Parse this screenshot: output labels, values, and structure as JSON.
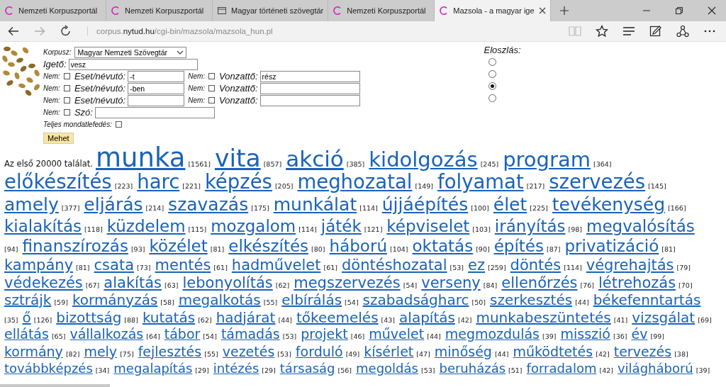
{
  "browser": {
    "tabs": [
      {
        "title": "Nemzeti Korpuszportál",
        "kind": "logo",
        "selected": false
      },
      {
        "title": "Nemzeti Korpuszportál",
        "kind": "logo",
        "selected": false
      },
      {
        "title": "Magyar történeti szövegtár",
        "kind": "page",
        "selected": false
      },
      {
        "title": "Nemzeti Korpuszportál",
        "kind": "logo",
        "selected": false
      },
      {
        "title": "Mazsola - a magyar ige",
        "kind": "logo",
        "selected": true
      }
    ],
    "url": "corpus.**nytud.hu**/cgi-bin/mazsola/mazsola_hun.pl"
  },
  "form": {
    "corpus_label": "Korpusz:",
    "corpus_value": "Magyar Nemzeti Szövegtár",
    "stem_label": "Igető:",
    "stem_value": "vesz",
    "filter_rows": [
      {
        "fields": [
          {
            "neg_label": "Nem:",
            "checked": false,
            "label": "Eset/névutó:",
            "value": "-t",
            "kind": "short"
          },
          {
            "neg_label": "Nem:",
            "checked": false,
            "label": "Vonzattő:",
            "value": "rész",
            "kind": "long"
          }
        ]
      },
      {
        "fields": [
          {
            "neg_label": "Nem:",
            "checked": false,
            "label": "Eset/névutó:",
            "value": "-ben",
            "kind": "short"
          },
          {
            "neg_label": "Nem:",
            "checked": false,
            "label": "Vonzattő:",
            "kind": "long"
          }
        ]
      },
      {
        "fields": [
          {
            "neg_label": "Nem:",
            "checked": false,
            "label": "Eset/névutó:",
            "kind": "short"
          },
          {
            "neg_label": "Nem:",
            "checked": false,
            "label": "Vonzattő:",
            "kind": "long"
          }
        ]
      },
      {
        "fields": [
          {
            "neg_label": "Nem:",
            "checked": false,
            "label": "Szó:",
            "kind": "word"
          }
        ]
      }
    ],
    "full_cover_label": "Teljes mondatlefedés:",
    "full_cover_checked": false,
    "submit": "Mehet",
    "distribution_label": "Eloszlás:",
    "distribution_options": [
      {
        "selected": false
      },
      {
        "selected": false
      },
      {
        "selected": true
      },
      {
        "selected": false
      }
    ]
  },
  "results": {
    "summary": "Az első 20000 találat.",
    "rows": [
      {
        "kind": "big",
        "items": [
          {
            "word": "munka",
            "count": "[1561]",
            "kind": "giant"
          },
          {
            "word": "vita",
            "count": "[857]",
            "kind": "huge"
          },
          {
            "word": "akció",
            "count": "[385]",
            "kind": "large"
          },
          {
            "word": "kidolgozás",
            "count": "[245]",
            "kind": "bigger"
          },
          {
            "word": "program",
            "count": "[364]",
            "kind": "bigger"
          }
        ]
      },
      {
        "kind": "big",
        "items": [
          {
            "word": "előkészítés",
            "count": "[223]"
          },
          {
            "word": "harc",
            "count": "[221]"
          },
          {
            "word": "képzés",
            "count": "[205]"
          },
          {
            "word": "meghozatal",
            "count": "[149]"
          },
          {
            "word": "folyamat",
            "count": "[217]"
          },
          {
            "word": "szervezés",
            "count": "[145]"
          }
        ]
      },
      {
        "kind": "medium",
        "items": [
          {
            "word": "amely",
            "count": "[377]"
          },
          {
            "word": "eljárás",
            "count": "[214]"
          },
          {
            "word": "szavazás",
            "count": "[175]"
          },
          {
            "word": "munkálat",
            "count": "[114]"
          },
          {
            "word": "újjáépítés",
            "count": "[100]"
          },
          {
            "word": "élet",
            "count": "[225]"
          },
          {
            "word": "tevékenység",
            "count": "[166]"
          }
        ]
      },
      {
        "kind": "normal",
        "items": [
          {
            "word": "kialakítás",
            "count": "[118]"
          },
          {
            "word": "küzdelem",
            "count": "[115]"
          },
          {
            "word": "mozgalom",
            "count": "[114]"
          },
          {
            "word": "játék",
            "count": "[121]"
          },
          {
            "word": "képviselet",
            "count": "[103]"
          },
          {
            "word": "irányítás",
            "count": "[98]"
          },
          {
            "word": "megvalósítás"
          }
        ]
      },
      {
        "kind": "normal",
        "items": [
          {
            "count": "[94]"
          },
          {
            "word": "finanszírozás",
            "count": "[93]"
          },
          {
            "word": "közélet",
            "count": "[81]"
          },
          {
            "word": "elkészítés",
            "count": "[80]"
          },
          {
            "word": "háború",
            "count": "[104]"
          },
          {
            "word": "oktatás",
            "count": "[90]"
          },
          {
            "word": "építés",
            "count": "[87]"
          },
          {
            "word": "privatizáció",
            "count": "[81]"
          }
        ]
      },
      {
        "kind": "small",
        "items": [
          {
            "word": "kampány",
            "count": "[81]"
          },
          {
            "word": "csata",
            "count": "[73]"
          },
          {
            "word": "mentés",
            "count": "[61]"
          },
          {
            "word": "hadművelet",
            "count": "[61]"
          },
          {
            "word": "döntéshozatal",
            "count": "[53]"
          },
          {
            "word": "ez",
            "count": "[259]"
          },
          {
            "word": "döntés",
            "count": "[114]"
          },
          {
            "word": "végrehajtás",
            "count": "[79]"
          }
        ]
      },
      {
        "kind": "small",
        "items": [
          {
            "word": "védekezés",
            "count": "[67]"
          },
          {
            "word": "alakítás",
            "count": "[63]"
          },
          {
            "word": "lebonyolítás",
            "count": "[62]"
          },
          {
            "word": "megszervezés",
            "count": "[54]"
          },
          {
            "word": "verseny",
            "count": "[84]"
          },
          {
            "word": "ellenőrzés",
            "count": "[76]"
          },
          {
            "word": "létrehozás",
            "count": "[70]"
          }
        ]
      },
      {
        "kind": "smaller",
        "items": [
          {
            "word": "sztrájk",
            "count": "[59]"
          },
          {
            "word": "kormányzás",
            "count": "[58]"
          },
          {
            "word": "megalkotás",
            "count": "[55]"
          },
          {
            "word": "elbírálás",
            "count": "[54]"
          },
          {
            "word": "szabadságharc",
            "count": "[50]"
          },
          {
            "word": "szerkesztés",
            "count": "[44]"
          },
          {
            "word": "békefenntartás"
          }
        ]
      },
      {
        "kind": "smaller",
        "items": [
          {
            "count": "[35]"
          },
          {
            "word": "ő",
            "count": "[126]"
          },
          {
            "word": "bizottság",
            "count": "[88]"
          },
          {
            "word": "kutatás",
            "count": "[62]"
          },
          {
            "word": "hadjárat",
            "count": "[44]"
          },
          {
            "word": "tőkeemelés",
            "count": "[43]"
          },
          {
            "word": "alapítás",
            "count": "[42]"
          },
          {
            "word": "munkabeszüntetés",
            "count": "[41]"
          },
          {
            "word": "vizsgálat",
            "count": "[69]"
          }
        ]
      },
      {
        "kind": "smallest",
        "items": [
          {
            "word": "ellátás",
            "count": "[65]"
          },
          {
            "word": "vállalkozás",
            "count": "[64]"
          },
          {
            "word": "tábor",
            "count": "[54]"
          },
          {
            "word": "támadás",
            "count": "[53]"
          },
          {
            "word": "projekt",
            "count": "[46]"
          },
          {
            "word": "művelet",
            "count": "[44]"
          },
          {
            "word": "megmozdulás",
            "count": "[39]"
          },
          {
            "word": "misszió",
            "count": "[36]"
          },
          {
            "word": "év",
            "count": "[99]"
          }
        ]
      },
      {
        "kind": "smallest",
        "items": [
          {
            "word": "kormány",
            "count": "[82]"
          },
          {
            "word": "mely",
            "count": "[75]"
          },
          {
            "word": "fejlesztés",
            "count": "[55]"
          },
          {
            "word": "vezetés",
            "count": "[53]"
          },
          {
            "word": "forduló",
            "count": "[49]"
          },
          {
            "word": "kísérlet",
            "count": "[47]"
          },
          {
            "word": "minőség",
            "count": "[44]"
          },
          {
            "word": "működtetés",
            "count": "[42]"
          },
          {
            "word": "tervezés",
            "count": "[38]"
          }
        ]
      },
      {
        "kind": "tiny",
        "items": [
          {
            "word": "továbbképzés",
            "count": "[34]"
          },
          {
            "word": "megalapítás",
            "count": "[29]"
          },
          {
            "word": "intézés",
            "count": "[29]"
          },
          {
            "word": "társaság",
            "count": "[56]"
          },
          {
            "word": "megoldás",
            "count": "[53]"
          },
          {
            "word": "beruházás",
            "count": "[51]"
          },
          {
            "word": "forradalom",
            "count": "[42]"
          },
          {
            "word": "világháború",
            "count": "[39]"
          }
        ]
      }
    ]
  }
}
